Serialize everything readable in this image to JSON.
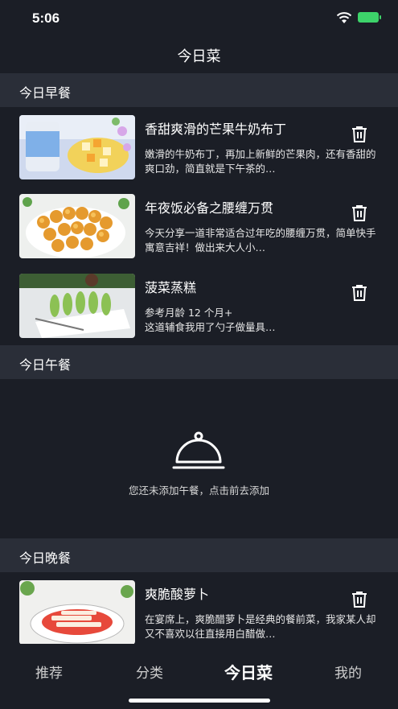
{
  "status_bar": {
    "time": "5:06"
  },
  "header": {
    "title": "今日菜"
  },
  "breakfast": {
    "heading": "今日早餐",
    "items": [
      {
        "title": "香甜爽滑的芒果牛奶布丁",
        "desc": "嫩滑的牛奶布丁，再加上新鲜的芒果肉，还有香甜的爽口劲，简直就是下午茶的…"
      },
      {
        "title": "年夜饭必备之腰缠万贯",
        "desc": "今天分享一道非常适合过年吃的腰缠万贯，简单快手寓意吉祥！做出来大人小…"
      },
      {
        "title": "菠菜蒸糕",
        "desc": "参考月龄 12 个月+\n这道辅食我用了勺子做量具…"
      }
    ]
  },
  "lunch": {
    "heading": "今日午餐",
    "empty_message": "您还未添加午餐，点击前去添加"
  },
  "dinner": {
    "heading": "今日晚餐",
    "items": [
      {
        "title": "爽脆酸萝卜",
        "desc": "在宴席上，爽脆醋萝卜是经典的餐前菜，我家某人却又不喜欢以往直接用白醋做…"
      }
    ]
  },
  "tabbar": {
    "tabs": [
      {
        "label": "推荐"
      },
      {
        "label": "分类"
      },
      {
        "label": "今日菜"
      },
      {
        "label": "我的"
      }
    ]
  },
  "colors": {
    "background": "#1b1e26",
    "section_header": "#2a2e38",
    "text": "#ffffff",
    "battery": "#3dd36a"
  }
}
